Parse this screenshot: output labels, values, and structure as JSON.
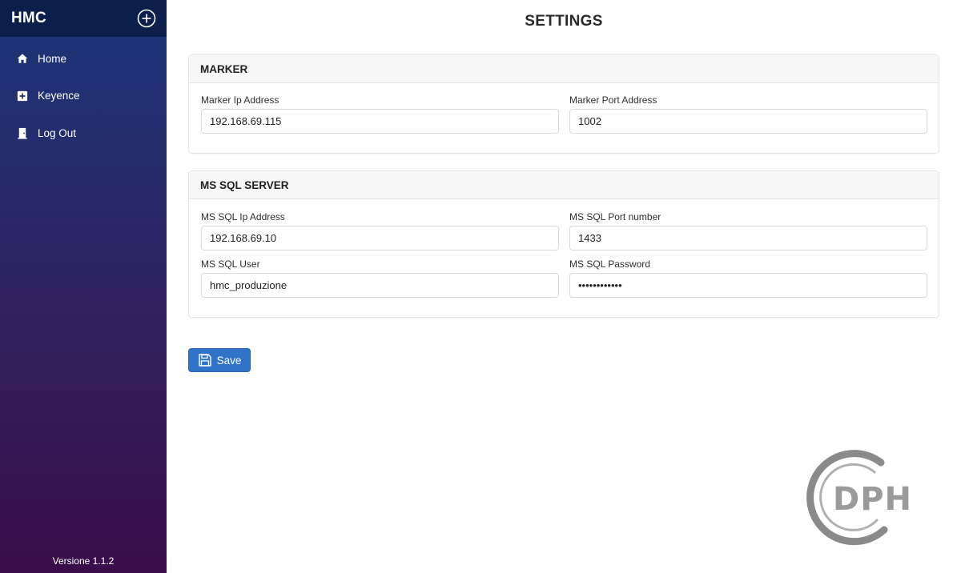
{
  "sidebar": {
    "brand": "HMC",
    "add_icon": "plus-circle-icon",
    "items": [
      {
        "label": "Home",
        "icon": "home-icon"
      },
      {
        "label": "Keyence",
        "icon": "plus-square-icon"
      },
      {
        "label": "Log Out",
        "icon": "door-icon"
      }
    ],
    "version": "Versione 1.1.2"
  },
  "page": {
    "title": "SETTINGS"
  },
  "marker": {
    "header": "MARKER",
    "ip_label": "Marker Ip Address",
    "ip_value": "192.168.69.115",
    "port_label": "Marker Port Address",
    "port_value": "1002"
  },
  "sql": {
    "header": "MS SQL SERVER",
    "ip_label": "MS SQL Ip Address",
    "ip_value": "192.168.69.10",
    "port_label": "MS SQL Port number",
    "port_value": "1433",
    "user_label": "MS SQL User",
    "user_value": "hmc_produzione",
    "password_label": "MS SQL Password",
    "password_value": "••••••••••••"
  },
  "actions": {
    "save_label": "Save",
    "save_icon": "floppy-disk-icon"
  },
  "logo": {
    "text": "DPH"
  },
  "colors": {
    "accent": "#2f74c8",
    "sidebar_top": "#1b3578",
    "sidebar_bottom": "#3a0d4a",
    "header_bar": "#0c1f4a"
  }
}
